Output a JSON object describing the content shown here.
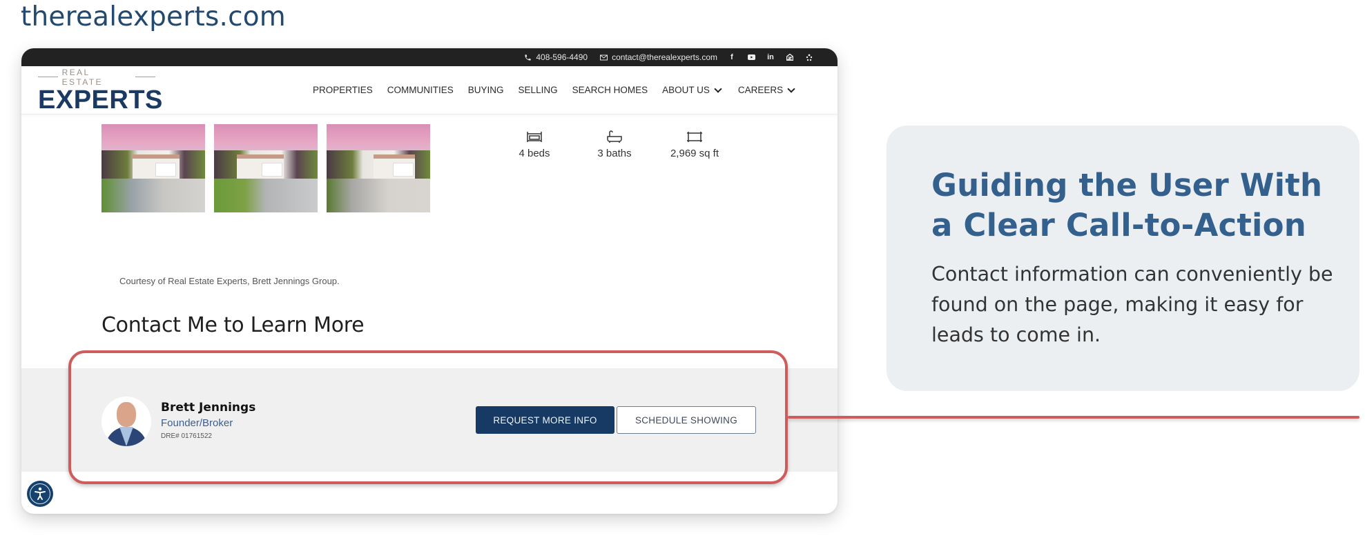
{
  "site_domain": "therealexperts.com",
  "topbar": {
    "phone": "408-596-4490",
    "email": "contact@therealexperts.com",
    "social_icons": [
      "facebook-icon",
      "youtube-icon",
      "linkedin-icon",
      "zillow-icon",
      "yelp-icon"
    ]
  },
  "logo": {
    "tagline": "REAL ESTATE",
    "name": "EXPERTS"
  },
  "nav": {
    "items": [
      {
        "label": "PROPERTIES",
        "dropdown": false
      },
      {
        "label": "COMMUNITIES",
        "dropdown": false
      },
      {
        "label": "BUYING",
        "dropdown": false
      },
      {
        "label": "SELLING",
        "dropdown": false
      },
      {
        "label": "SEARCH HOMES",
        "dropdown": false
      },
      {
        "label": "ABOUT US",
        "dropdown": true
      },
      {
        "label": "CAREERS",
        "dropdown": true
      }
    ]
  },
  "listing": {
    "photos": [
      "house-photo-front",
      "house-photo-angle",
      "house-photo-driveway"
    ],
    "specs": [
      {
        "icon": "bed-icon",
        "label": "4 beds"
      },
      {
        "icon": "bathtub-icon",
        "label": "3 baths"
      },
      {
        "icon": "area-icon",
        "label": "2,969 sq ft"
      }
    ],
    "courtesy": "Courtesy of Real Estate Experts, Brett Jennings Group."
  },
  "contact": {
    "title": "Contact Me to Learn More",
    "agent": {
      "name": "Brett Jennings",
      "role": "Founder/Broker",
      "license": "DRE# 01761522"
    },
    "primary_button": "REQUEST MORE INFO",
    "secondary_button": "SCHEDULE SHOWING"
  },
  "accessibility_button": "accessibility-icon",
  "callout": {
    "title_line1": "Guiding the User With",
    "title_line2": "a Clear Call-to-Action",
    "body": "Contact information can conveniently be found on the page, making it easy for leads to come in."
  },
  "colors": {
    "brand_navy": "#163a63",
    "callout_title": "#33608d",
    "annotation_red": "#cd5c5c",
    "callout_bg": "#eceff2",
    "topbar_bg": "#222222"
  }
}
